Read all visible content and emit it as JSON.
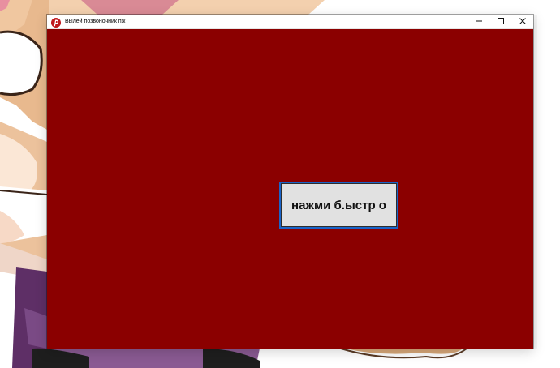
{
  "window": {
    "title": "Вылей позвоночник пж",
    "icon_name": "pinterest-like-app-icon",
    "background_color": "#8b0000"
  },
  "titlebar_controls": {
    "minimize_icon": "minimize-icon",
    "maximize_icon": "maximize-icon",
    "close_icon": "close-icon"
  },
  "main_button": {
    "label": "нажми б.ыстр о"
  },
  "colors": {
    "accent_border": "#1a64c8",
    "button_fill": "#e1e1e1",
    "window_fill": "#8b0000"
  }
}
